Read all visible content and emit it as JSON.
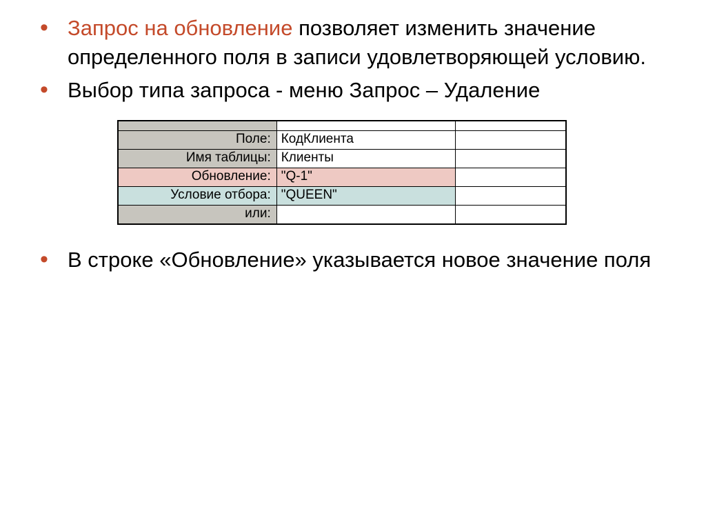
{
  "bullets": {
    "b1_red": "Запрос на обновление",
    "b1_rest": " позволяет изменить значение определенного поля в записи удовлетворяющей условию.",
    "b2": "Выбор типа запроса - меню Запрос – Удаление",
    "b3": "В строке «Обновление» указывается новое значение поля"
  },
  "grid": {
    "rows": [
      {
        "label": "Поле:",
        "val": "КодКлиента",
        "val2": ""
      },
      {
        "label": "Имя таблицы:",
        "val": "Клиенты",
        "val2": ""
      },
      {
        "label": "Обновление:",
        "val": "\"Q-1\"",
        "val2": ""
      },
      {
        "label": "Условие отбора:",
        "val": "\"QUEEN\"",
        "val2": ""
      },
      {
        "label": "или:",
        "val": "",
        "val2": ""
      }
    ]
  },
  "colors": {
    "accent": "#c44a2a",
    "row_update": "#eec9c3",
    "row_condition": "#c9e0de",
    "chrome": "#c7c5be"
  }
}
